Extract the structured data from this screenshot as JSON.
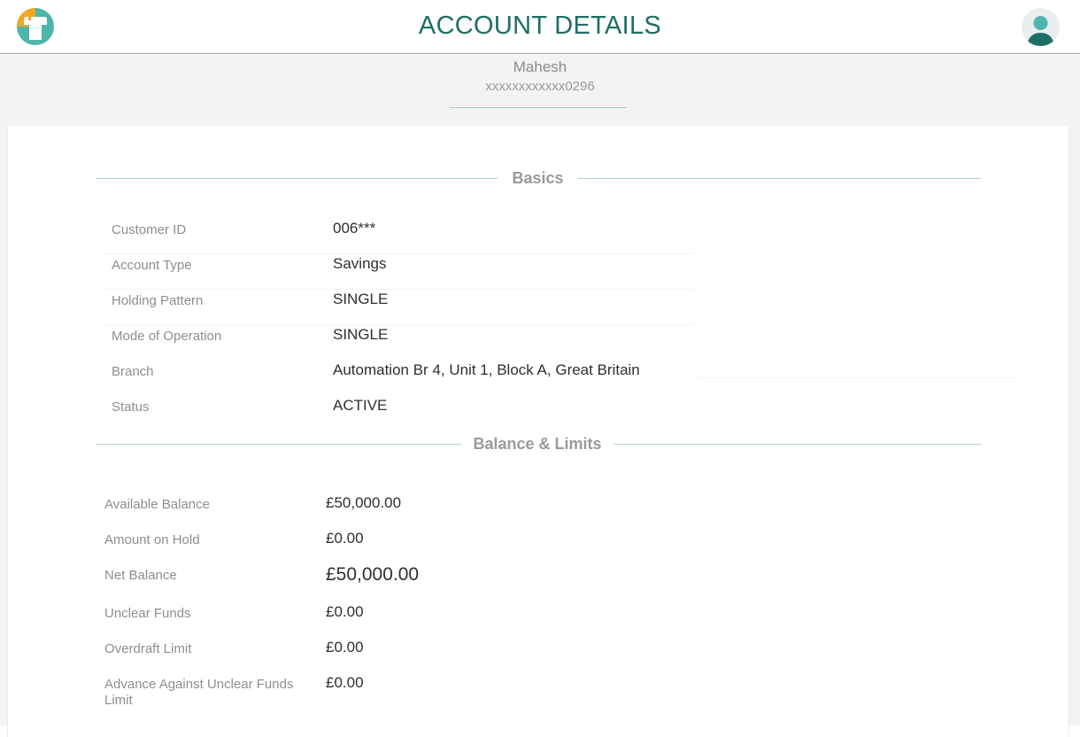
{
  "header": {
    "title": "ACCOUNT DETAILS",
    "logo_icon": "bank-logo-icon",
    "avatar_icon": "user-avatar-icon",
    "title_color": "#1d6e66"
  },
  "account": {
    "name": "Mahesh",
    "number": "xxxxxxxxxxxx0296"
  },
  "basics": {
    "title": "Basics",
    "rows": [
      {
        "label": "Customer ID",
        "value": "006***"
      },
      {
        "label": "Account Type",
        "value": "Savings"
      },
      {
        "label": "Holding Pattern",
        "value": "SINGLE"
      },
      {
        "label": "Mode of Operation",
        "value": "SINGLE"
      },
      {
        "label": "Branch",
        "value": "Automation Br 4, Unit 1, Block A, Great Britain"
      },
      {
        "label": "Status",
        "value": "ACTIVE"
      }
    ]
  },
  "balance": {
    "title": "Balance & Limits",
    "rows": [
      {
        "label": "Available Balance",
        "value": "£50,000.00"
      },
      {
        "label": "Amount on Hold",
        "value": "£0.00"
      },
      {
        "label": "Net Balance",
        "value": "£50,000.00"
      },
      {
        "label": "Unclear Funds",
        "value": "£0.00"
      },
      {
        "label": "Overdraft Limit",
        "value": "£0.00"
      },
      {
        "label": "Advance Against Unclear Funds Limit",
        "value": "£0.00"
      }
    ]
  }
}
